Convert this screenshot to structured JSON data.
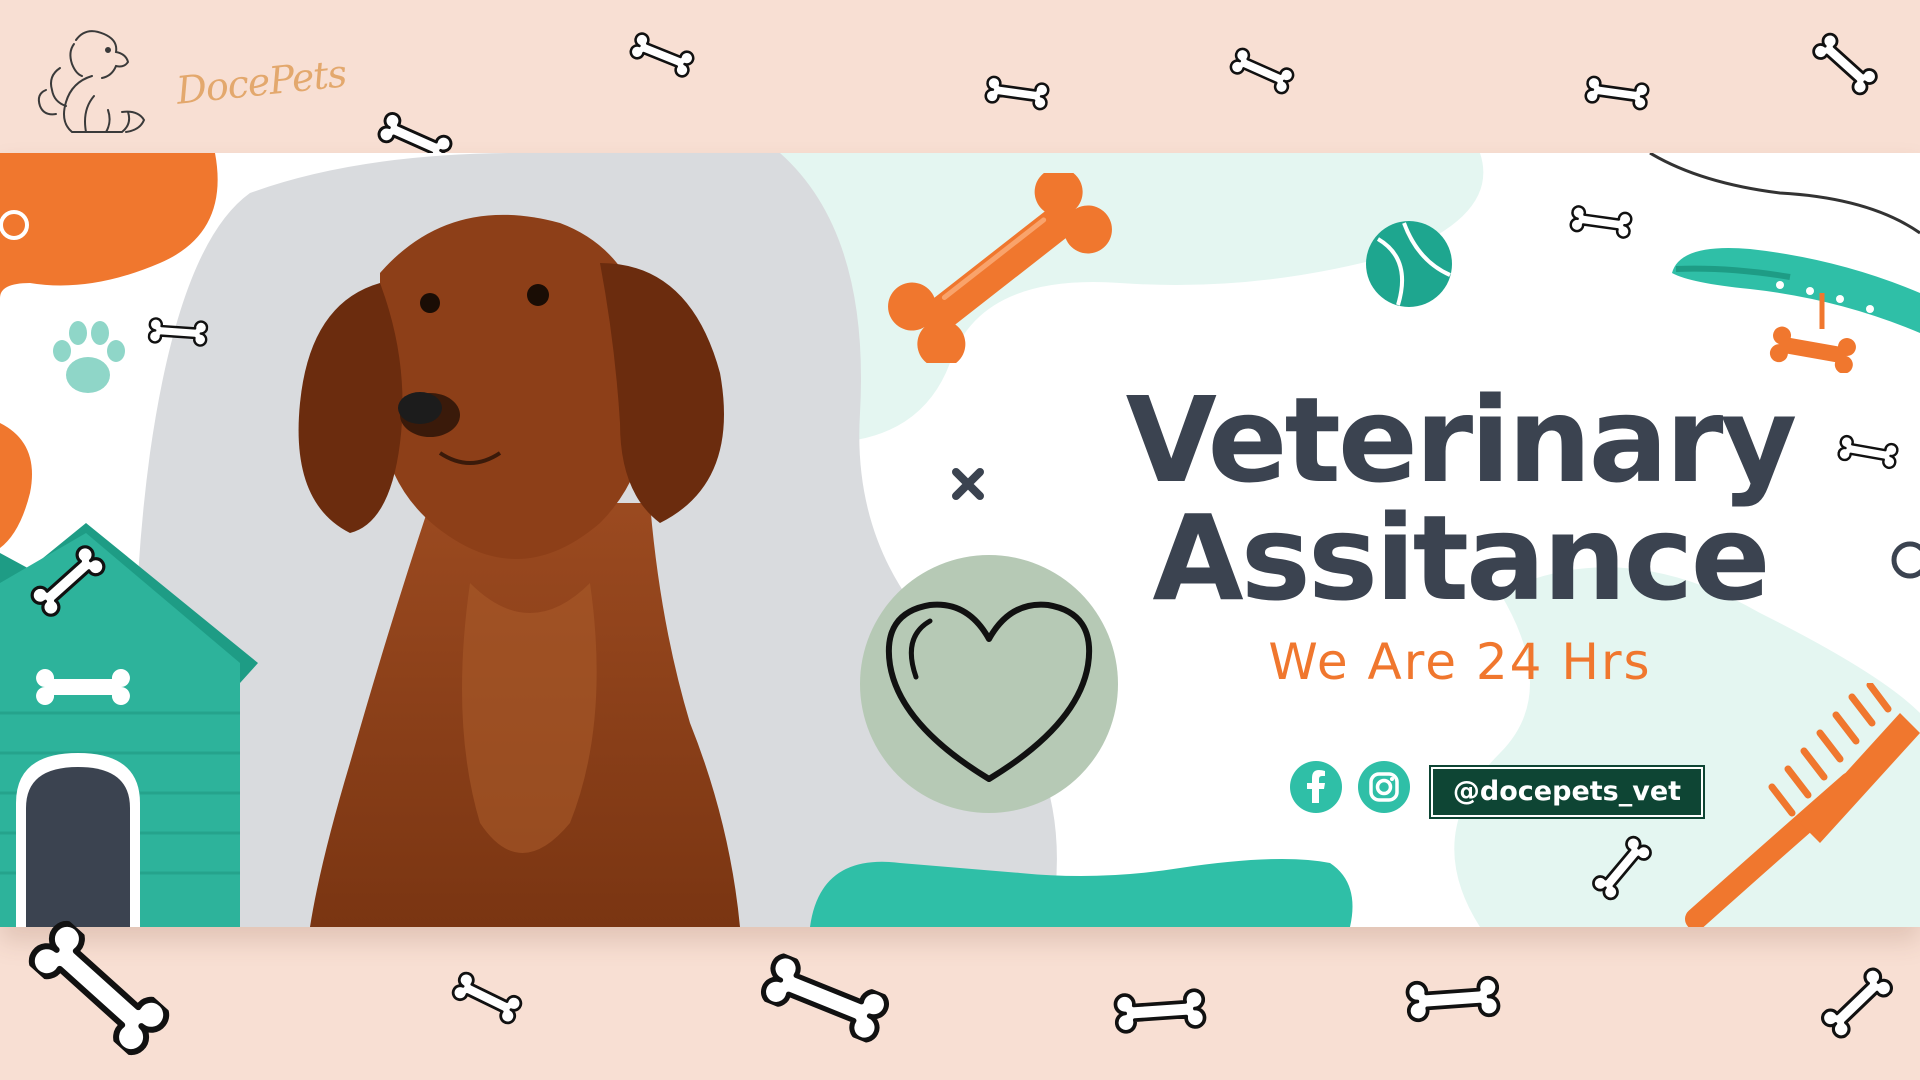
{
  "brand": {
    "name": "DocePets"
  },
  "banner": {
    "title_line1": "Veterinary",
    "title_line2": "Assitance",
    "tagline": "We Are 24 Hrs",
    "social": {
      "facebook_icon": "facebook-icon",
      "instagram_icon": "instagram-icon",
      "handle": "@docepets_vet"
    }
  },
  "colors": {
    "page_background": "#f8dfd3",
    "orange": "#f0772e",
    "teal": "#2fbfa7",
    "dark_text": "#3b4350",
    "handle_background": "#0e4534",
    "heart_circle": "#b6c9b5"
  },
  "icons": [
    "bone-icon",
    "paw-icon",
    "heart-icon",
    "tennis-ball-icon",
    "dog-collar-icon",
    "pet-comb-icon",
    "doghouse-icon",
    "close-x-icon"
  ]
}
